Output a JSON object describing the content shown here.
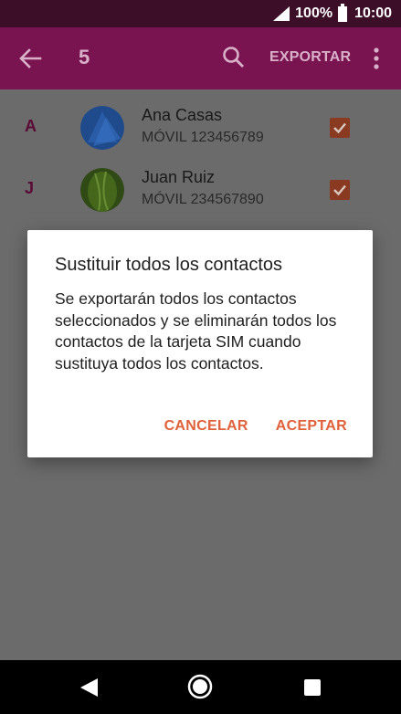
{
  "status_bar": {
    "battery": "100%",
    "time": "10:00"
  },
  "app_bar": {
    "count": "5",
    "export_label": "EXPORTAR"
  },
  "contacts": [
    {
      "letter": "A",
      "name": "Ana Casas",
      "phone": "MÓVIL 123456789",
      "checked": true
    },
    {
      "letter": "J",
      "name": "Juan Ruiz",
      "phone": "MÓVIL 234567890",
      "checked": true
    }
  ],
  "dialog": {
    "title": "Sustituir todos los contactos",
    "message": "Se exportarán todos los contactos seleccionados y se eliminarán todos los contactos de la tarjeta SIM cuando sustituya todos los contactos.",
    "cancel_label": "CANCELAR",
    "accept_label": "ACEPTAR"
  },
  "icons": {
    "back": "back-arrow-icon",
    "search": "search-icon",
    "more": "more-vert-icon",
    "checkbox": "checkbox-checked-icon"
  },
  "colors": {
    "status_bar": "#3c0e28",
    "app_bar": "#7a1450",
    "accent": "#e0613a",
    "scrim_background": "#6b6b6b"
  }
}
